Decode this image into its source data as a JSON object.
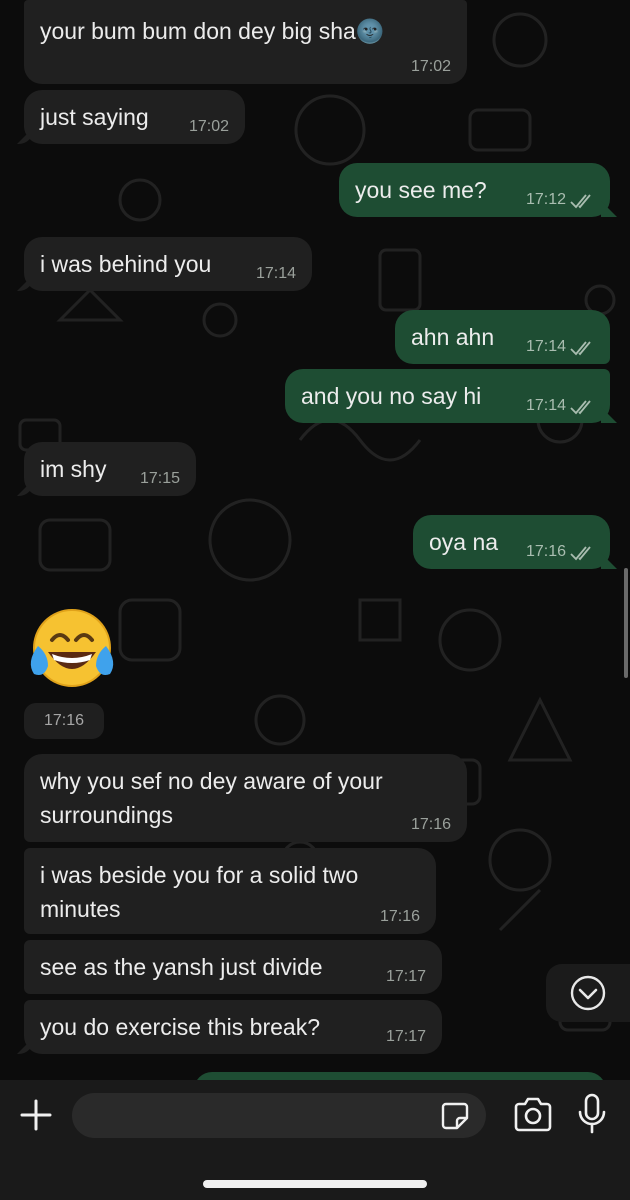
{
  "messages": [
    {
      "text": "your bum bum don dey big sha🌚",
      "time": "17:02",
      "dir": "in"
    },
    {
      "text": "just saying",
      "time": "17:02",
      "dir": "in"
    },
    {
      "text": "you see me?",
      "time": "17:12",
      "dir": "out"
    },
    {
      "text": "i was behind you",
      "time": "17:14",
      "dir": "in"
    },
    {
      "text": "ahn ahn",
      "time": "17:14",
      "dir": "out"
    },
    {
      "text": "and you no say hi",
      "time": "17:14",
      "dir": "out"
    },
    {
      "text": "im shy",
      "time": "17:15",
      "dir": "in"
    },
    {
      "text": "oya na",
      "time": "17:16",
      "dir": "out"
    },
    {
      "text": "why you sef no dey aware of your surroundings",
      "time": "17:16",
      "dir": "in"
    },
    {
      "text": "i was beside you for a solid two minutes",
      "time": "17:16",
      "dir": "in"
    },
    {
      "text": "see as the yansh just divide",
      "time": "17:17",
      "dir": "in"
    },
    {
      "text": "you do exercise this break?",
      "time": "17:17",
      "dir": "in"
    }
  ],
  "emoji_message": {
    "emoji": "face-with-tears-of-joy",
    "time": "17:16"
  },
  "composer": {
    "placeholder": ""
  },
  "icons": {
    "attach": "plus-icon",
    "sticker": "sticker-icon",
    "camera": "camera-icon",
    "mic": "microphone-icon",
    "scroll_down": "chevron-down-circle-icon",
    "read_receipt": "double-check-icon"
  },
  "colors": {
    "background": "#0c0c0c",
    "incoming_bubble": "#202020",
    "outgoing_bubble": "#1e4d33",
    "text": "#ececec",
    "timestamp": "#9aa09b"
  }
}
